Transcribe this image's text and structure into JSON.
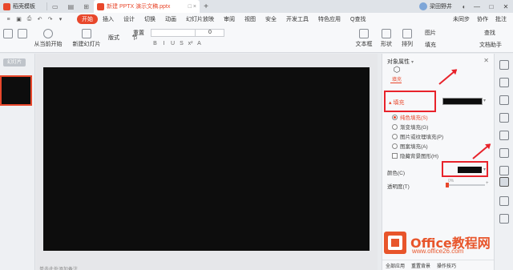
{
  "titlebar": {
    "home_tab": "稻壳模板",
    "doc_tab": "新建 PPTX 演示文稿.pptx",
    "doc_tab_extra": "□ ×",
    "plus": "+",
    "sync": "未同步",
    "collab": "协作",
    "share": "分享",
    "user": "梁田野井",
    "win_min": "—",
    "win_max": "□",
    "win_close": "✕"
  },
  "menubar": {
    "items": [
      "开始",
      "插入",
      "设计",
      "切换",
      "动画",
      "幻灯片放映",
      "审阅",
      "视图",
      "安全",
      "开发工具",
      "特色应用"
    ],
    "search": "Q查找",
    "right": [
      "未同步",
      "协作",
      "批注"
    ],
    "active_index": 0
  },
  "toolbar": {
    "from_current": "从当前开始",
    "new_slide": "新建幻灯片",
    "layout": "版式",
    "section": "节",
    "reset": "重置",
    "font_size": "0",
    "textbox": "文本框",
    "shape": "形状",
    "arrange": "排列",
    "picture": "图片",
    "fill": "填充",
    "find": "查找",
    "wordart": "文档助手"
  },
  "leftpane": {
    "tab": "幻灯片",
    "slide_number": "1"
  },
  "canvas": {
    "notes": "单击此处添加备注"
  },
  "rpanel": {
    "title": "对象属性",
    "fill_tab": "填充",
    "section": "填充",
    "options": [
      {
        "label": "纯色填充(S)",
        "type": "radio",
        "selected": true
      },
      {
        "label": "渐变填充(G)",
        "type": "radio",
        "selected": false
      },
      {
        "label": "图片或纹理填充(P)",
        "type": "radio",
        "selected": false
      },
      {
        "label": "图案填充(A)",
        "type": "radio",
        "selected": false
      },
      {
        "label": "隐藏背景图形(H)",
        "type": "check",
        "selected": false
      }
    ],
    "color_label": "颜色(C)",
    "transparency_label": "透明度(T)",
    "transparency_value": "0%",
    "bottom": [
      "全部应用",
      "重置背景",
      "操作技巧"
    ]
  },
  "watermark": {
    "line1": "Office教程网",
    "line2": "www.office26.com"
  },
  "colors": {
    "accent": "#e8472b",
    "annotation": "#e8232b",
    "slide_bg": "#0d0d0d"
  }
}
